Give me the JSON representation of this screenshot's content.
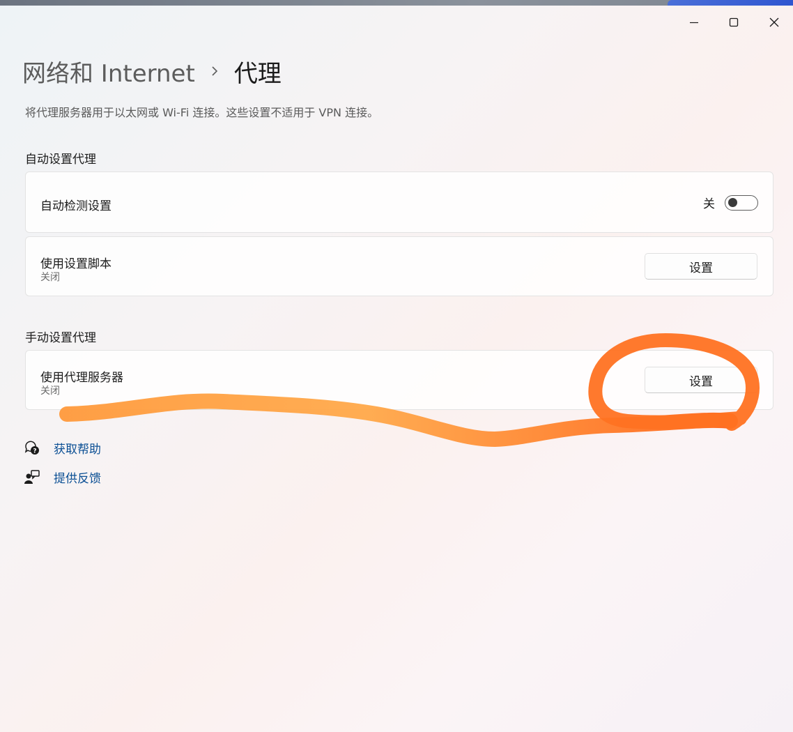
{
  "window": {
    "controls": {
      "minimize": "minimize-icon",
      "maximize": "maximize-icon",
      "close": "close-icon"
    }
  },
  "breadcrumb": {
    "parent": "网络和 Internet",
    "current": "代理"
  },
  "description": "将代理服务器用于以太网或 Wi-Fi 连接。这些设置不适用于 VPN 连接。",
  "auto_proxy": {
    "section_title": "自动设置代理",
    "auto_detect": {
      "title": "自动检测设置",
      "toggle_label": "关",
      "toggle_on": false
    },
    "setup_script": {
      "title": "使用设置脚本",
      "status": "关闭",
      "button_label": "设置"
    }
  },
  "manual_proxy": {
    "section_title": "手动设置代理",
    "proxy_server": {
      "title": "使用代理服务器",
      "status": "关闭",
      "button_label": "设置"
    }
  },
  "links": {
    "help": {
      "label": "获取帮助",
      "icon": "help-chat-icon"
    },
    "feedback": {
      "label": "提供反馈",
      "icon": "feedback-person-icon"
    }
  },
  "colors": {
    "link": "#0b4f94",
    "annotation_start": "#ffa94a",
    "annotation_end": "#ff6a1a"
  }
}
